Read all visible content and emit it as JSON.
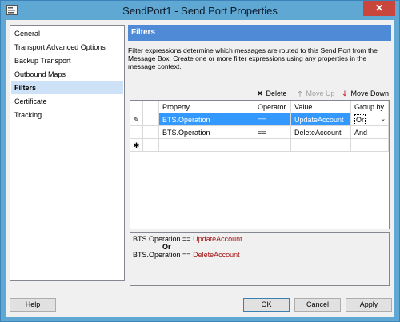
{
  "window": {
    "title": "SendPort1 - Send Port Properties",
    "close_label": "✕",
    "accent": "#5fa8d3"
  },
  "nav": {
    "items": [
      {
        "label": "General",
        "selected": false
      },
      {
        "label": "Transport Advanced Options",
        "selected": false
      },
      {
        "label": "Backup Transport",
        "selected": false
      },
      {
        "label": "Outbound Maps",
        "selected": false
      },
      {
        "label": "Filters",
        "selected": true
      },
      {
        "label": "Certificate",
        "selected": false
      },
      {
        "label": "Tracking",
        "selected": false
      }
    ]
  },
  "panel": {
    "header": "Filters",
    "description": "Filter expressions determine which messages are routed to this Send Port from the Message Box. Create one or more filter expressions using any properties in the message context."
  },
  "toolbar": {
    "delete_label": "Delete",
    "delete_icon": "delete-x-icon",
    "move_up_label": "Move Up",
    "move_up_icon": "arrow-up-icon",
    "move_down_label": "Move Down",
    "move_down_icon": "arrow-down-icon"
  },
  "grid": {
    "columns": [
      "Property",
      "Operator",
      "Value",
      "Group by"
    ],
    "rows": [
      {
        "marker": "✎",
        "property": "BTS.Operation",
        "operator": "==",
        "value": "UpdateAccount",
        "group_by": "Or",
        "selected": true
      },
      {
        "marker": "",
        "property": "BTS.Operation",
        "operator": "==",
        "value": "DeleteAccount",
        "group_by": "And",
        "selected": false
      }
    ],
    "new_row_marker": "✱"
  },
  "filter_preview": {
    "line1_property": "BTS.Operation",
    "line1_operator": "==",
    "line1_value": "UpdateAccount",
    "group_operator": "Or",
    "line2_property": "BTS.Operation",
    "line2_operator": "==",
    "line2_value": "DeleteAccount"
  },
  "buttons": {
    "help": "Help",
    "ok": "OK",
    "cancel": "Cancel",
    "apply": "Apply"
  }
}
